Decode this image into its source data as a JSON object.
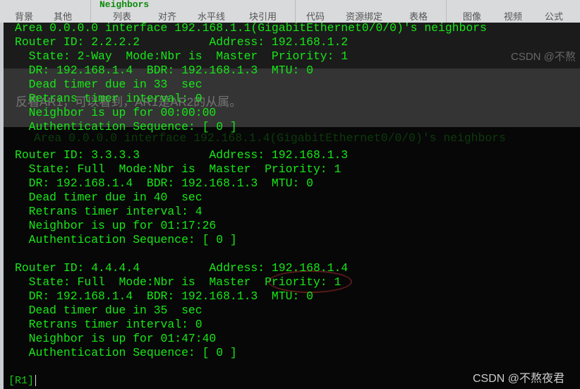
{
  "toolbar": {
    "partial_title": "Neighbors",
    "items": [
      "背景",
      "其他",
      "列表",
      "对齐",
      "水平线",
      "块引用",
      "代码",
      "资源绑定",
      "表格",
      "图像",
      "视频",
      "公式"
    ]
  },
  "background_sentence": "反看AR1，可以看到，AR1是AR2的从属。",
  "terminal": {
    "lines": [
      "Area 0.0.0.0 interface 192.168.1.1(GigabitEthernet0/0/0)'s neighbors",
      "Router ID: 2.2.2.2          Address: 192.168.1.2",
      "  State: 2-Way  Mode:Nbr is  Master  Priority: 1",
      "  DR: 192.168.1.4  BDR: 192.168.1.3  MTU: 0",
      "  Dead timer due in 33  sec",
      "  Retrans timer interval: 0",
      "  Neighbor is up for 00:00:00",
      "  Authentication Sequence: [ 0 ]",
      "",
      "Router ID: 3.3.3.3          Address: 192.168.1.3",
      "  State: Full  Mode:Nbr is  Master  Priority: 1",
      "  DR: 192.168.1.4  BDR: 192.168.1.3  MTU: 0",
      "  Dead timer due in 40  sec",
      "  Retrans timer interval: 4",
      "  Neighbor is up for 01:17:26",
      "  Authentication Sequence: [ 0 ]",
      "",
      "Router ID: 4.4.4.4          Address: 192.168.1.4",
      "  State: Full  Mode:Nbr is  Master  Priority: 1",
      "  DR: 192.168.1.4  BDR: 192.168.1.3  MTU: 0",
      "  Dead timer due in 35  sec",
      "  Retrans timer interval: 0",
      "  Neighbor is up for 01:47:40",
      "  Authentication Sequence: [ 0 ]"
    ],
    "prompt": "[R1]"
  },
  "ghost_lines": [
    "Area 0.0.0.0 interface 192.168.1.4(GigabitEthernet0/0/0)'s neighbors"
  ],
  "watermarks": {
    "top": "CSDN @不熬",
    "bottom": "CSDN @不熬夜君"
  },
  "colors": {
    "terminal_text": "#17e817",
    "terminal_bg": "#070707"
  }
}
